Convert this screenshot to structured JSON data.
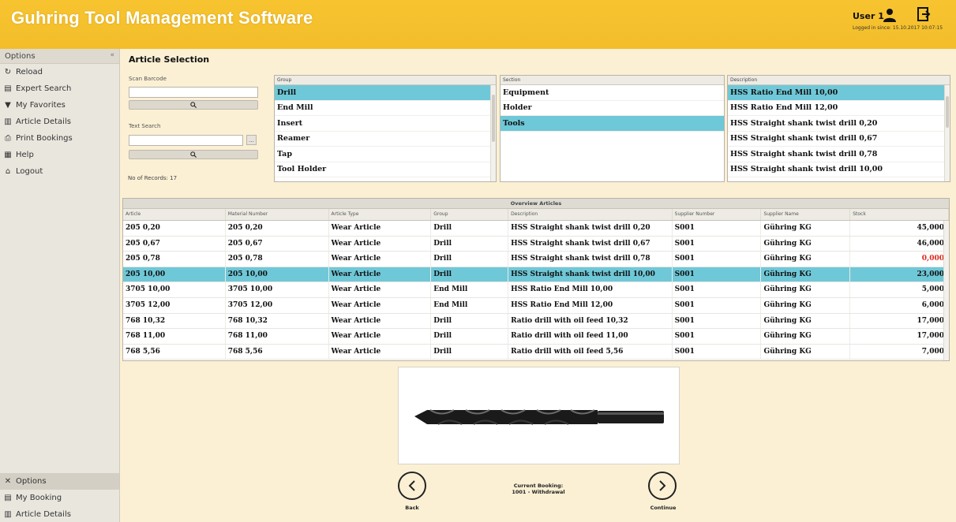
{
  "header": {
    "title": "Guhring Tool Management Software",
    "user": "User 1",
    "logged_in": "Logged in since: 15.10.2017 10:07:15",
    "icons": [
      "user-icon",
      "logout-icon"
    ]
  },
  "sidebar": {
    "title": "Options",
    "collapse": "«",
    "items": [
      {
        "label": "Reload",
        "icon": "reload-icon"
      },
      {
        "label": "Expert Search",
        "icon": "search-doc-icon"
      },
      {
        "label": "My Favorites",
        "icon": "filter-icon"
      },
      {
        "label": "Article Details",
        "icon": "details-icon"
      },
      {
        "label": "Print Bookings",
        "icon": "print-icon"
      },
      {
        "label": "Help",
        "icon": "help-icon"
      },
      {
        "label": "Logout",
        "icon": "home-icon"
      }
    ],
    "bottom": [
      {
        "label": "Options",
        "icon": "tools-icon"
      },
      {
        "label": "My Booking",
        "icon": "list-icon"
      },
      {
        "label": "Article Details",
        "icon": "details-icon"
      }
    ]
  },
  "main": {
    "title": "Article Selection",
    "scan_barcode_label": "Scan Barcode",
    "scan_barcode_value": "",
    "text_search_label": "Text Search",
    "text_search_value": "",
    "dots": "...",
    "records": "No of Records: 17"
  },
  "group": {
    "header": "Group",
    "items": [
      "Drill",
      "End Mill",
      "Insert",
      "Reamer",
      "Tap",
      "Tool Holder"
    ],
    "selected": 0
  },
  "section": {
    "header": "Section",
    "items": [
      "Equipment",
      "Holder",
      "Tools"
    ],
    "selected": 2
  },
  "description": {
    "header": "Description",
    "items": [
      "HSS Ratio End Mill 10,00",
      "HSS Ratio End Mill 12,00",
      "HSS Straight shank twist drill 0,20",
      "HSS Straight shank twist drill 0,67",
      "HSS Straight shank twist drill 0,78",
      "HSS Straight shank twist drill 10,00"
    ],
    "selected": 0
  },
  "table": {
    "caption": "Overview Articles",
    "columns": [
      "Article",
      "Material Number",
      "Article Type",
      "Group",
      "Description",
      "Supplier Number",
      "Supplier Name",
      "Stock"
    ],
    "rows": [
      [
        "205 0,20",
        "205 0,20",
        "Wear Article",
        "Drill",
        "HSS Straight shank twist drill 0,20",
        "S001",
        "Gühring KG",
        "45,000"
      ],
      [
        "205 0,67",
        "205 0,67",
        "Wear Article",
        "Drill",
        "HSS Straight shank twist drill 0,67",
        "S001",
        "Gühring KG",
        "46,000"
      ],
      [
        "205 0,78",
        "205 0,78",
        "Wear Article",
        "Drill",
        "HSS Straight shank twist drill 0,78",
        "S001",
        "Gühring KG",
        "0,000"
      ],
      [
        "205 10,00",
        "205 10,00",
        "Wear Article",
        "Drill",
        "HSS Straight shank twist drill 10,00",
        "S001",
        "Gühring KG",
        "23,000"
      ],
      [
        "3705 10,00",
        "3705 10,00",
        "Wear Article",
        "End Mill",
        "HSS Ratio End Mill 10,00",
        "S001",
        "Gühring KG",
        "5,000"
      ],
      [
        "3705 12,00",
        "3705 12,00",
        "Wear Article",
        "End Mill",
        "HSS Ratio End Mill 12,00",
        "S001",
        "Gühring KG",
        "6,000"
      ],
      [
        "768 10,32",
        "768 10,32",
        "Wear Article",
        "Drill",
        "Ratio drill with oil feed 10,32",
        "S001",
        "Gühring KG",
        "17,000"
      ],
      [
        "768 11,00",
        "768 11,00",
        "Wear Article",
        "Drill",
        "Ratio drill with oil feed 11,00",
        "S001",
        "Gühring KG",
        "17,000"
      ],
      [
        "768 5,56",
        "768 5,56",
        "Wear Article",
        "Drill",
        "Ratio drill with oil feed 5,56",
        "S001",
        "Gühring KG",
        "7,000"
      ]
    ],
    "selected": 3,
    "zero_stock_color": "#e0281e",
    "selection_color": "#6fc8d8"
  },
  "preview": {
    "icon": "twist-drill-image"
  },
  "nav": {
    "back": "Back",
    "continue": "Continue",
    "booking_title": "Current Booking:",
    "booking_value": "1001 - Withdrawal"
  },
  "colors": {
    "header": "#f3bd2a",
    "background": "#fbf0d4",
    "selection": "#6fc8d8"
  }
}
